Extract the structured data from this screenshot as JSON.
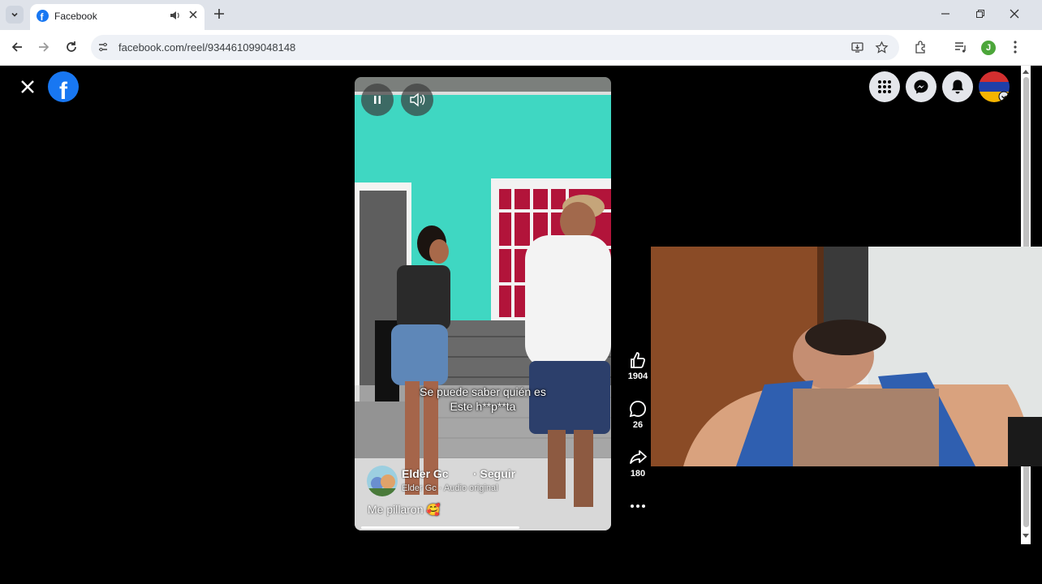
{
  "browser": {
    "tab_title": "Facebook",
    "url": "facebook.com/reel/934461099048148",
    "profile_initial": "J"
  },
  "reel": {
    "caption_line1": "Se puede saber quién es",
    "caption_line2": "Este h**p**ta",
    "author": "Elder Gc",
    "follow_label": "· Seguir",
    "audio": "Elder Gc · Audio original",
    "description": "Me pillaron 🥰",
    "progress": 0.65
  },
  "actions": {
    "likes": "1904",
    "comments": "26",
    "shares": "180"
  },
  "colors": {
    "facebook_blue": "#1877f2",
    "wall_teal": "#3fd7c2"
  }
}
